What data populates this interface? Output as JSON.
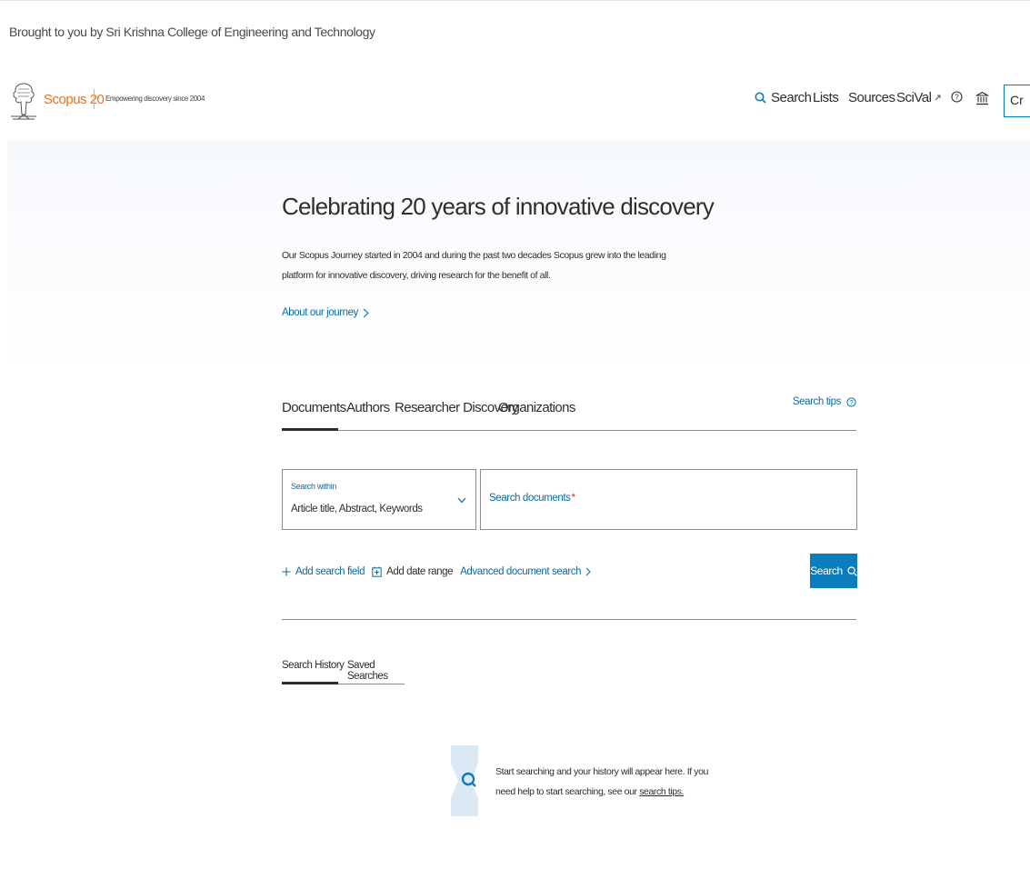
{
  "institution": {
    "text": "Brought to you by Sri Krishna College of Engineering and Technology"
  },
  "header": {
    "brand": "Scopus",
    "brand_number": "20",
    "tagline": "Empowering discovery since 2004",
    "nav": {
      "search": "Search",
      "lists": "Lists",
      "sources": "Sources",
      "scival": "SciVal",
      "create_account": "Cr"
    }
  },
  "hero": {
    "title": "Celebrating 20 years of innovative discovery",
    "body": "Our Scopus Journey started in 2004 and during the past two decades Scopus grew into the leading platform for innovative discovery, driving research for the benefit of all.",
    "link": "About our journey"
  },
  "search": {
    "tabs": [
      "Documents",
      "Authors",
      "Researcher Discovery",
      "Organizations"
    ],
    "active_tab": "Documents",
    "tips": "Search tips",
    "within_label": "Search within",
    "within_value": "Article title, Abstract, Keywords",
    "placeholder": "Search documents",
    "required_marker": "*",
    "add_field": "Add search field",
    "add_date": "Add date range",
    "advanced": "Advanced document search",
    "button": "Search"
  },
  "history": {
    "tabs": [
      "Search History",
      "Saved Searches"
    ],
    "active_tab": "Search History",
    "empty_text": "Start searching and your history will appear here. If you need help to start searching, see our",
    "empty_link": "search tips."
  },
  "colors": {
    "accent": "#0c7dbb",
    "link": "#0c6aa1",
    "brand_orange": "#e9711c",
    "required": "#d4252a"
  },
  "icons": [
    "search-icon",
    "external-link-icon",
    "help-icon",
    "institution-icon",
    "chevron-right-icon",
    "chevron-down-icon",
    "plus-icon",
    "calendar-icon"
  ]
}
